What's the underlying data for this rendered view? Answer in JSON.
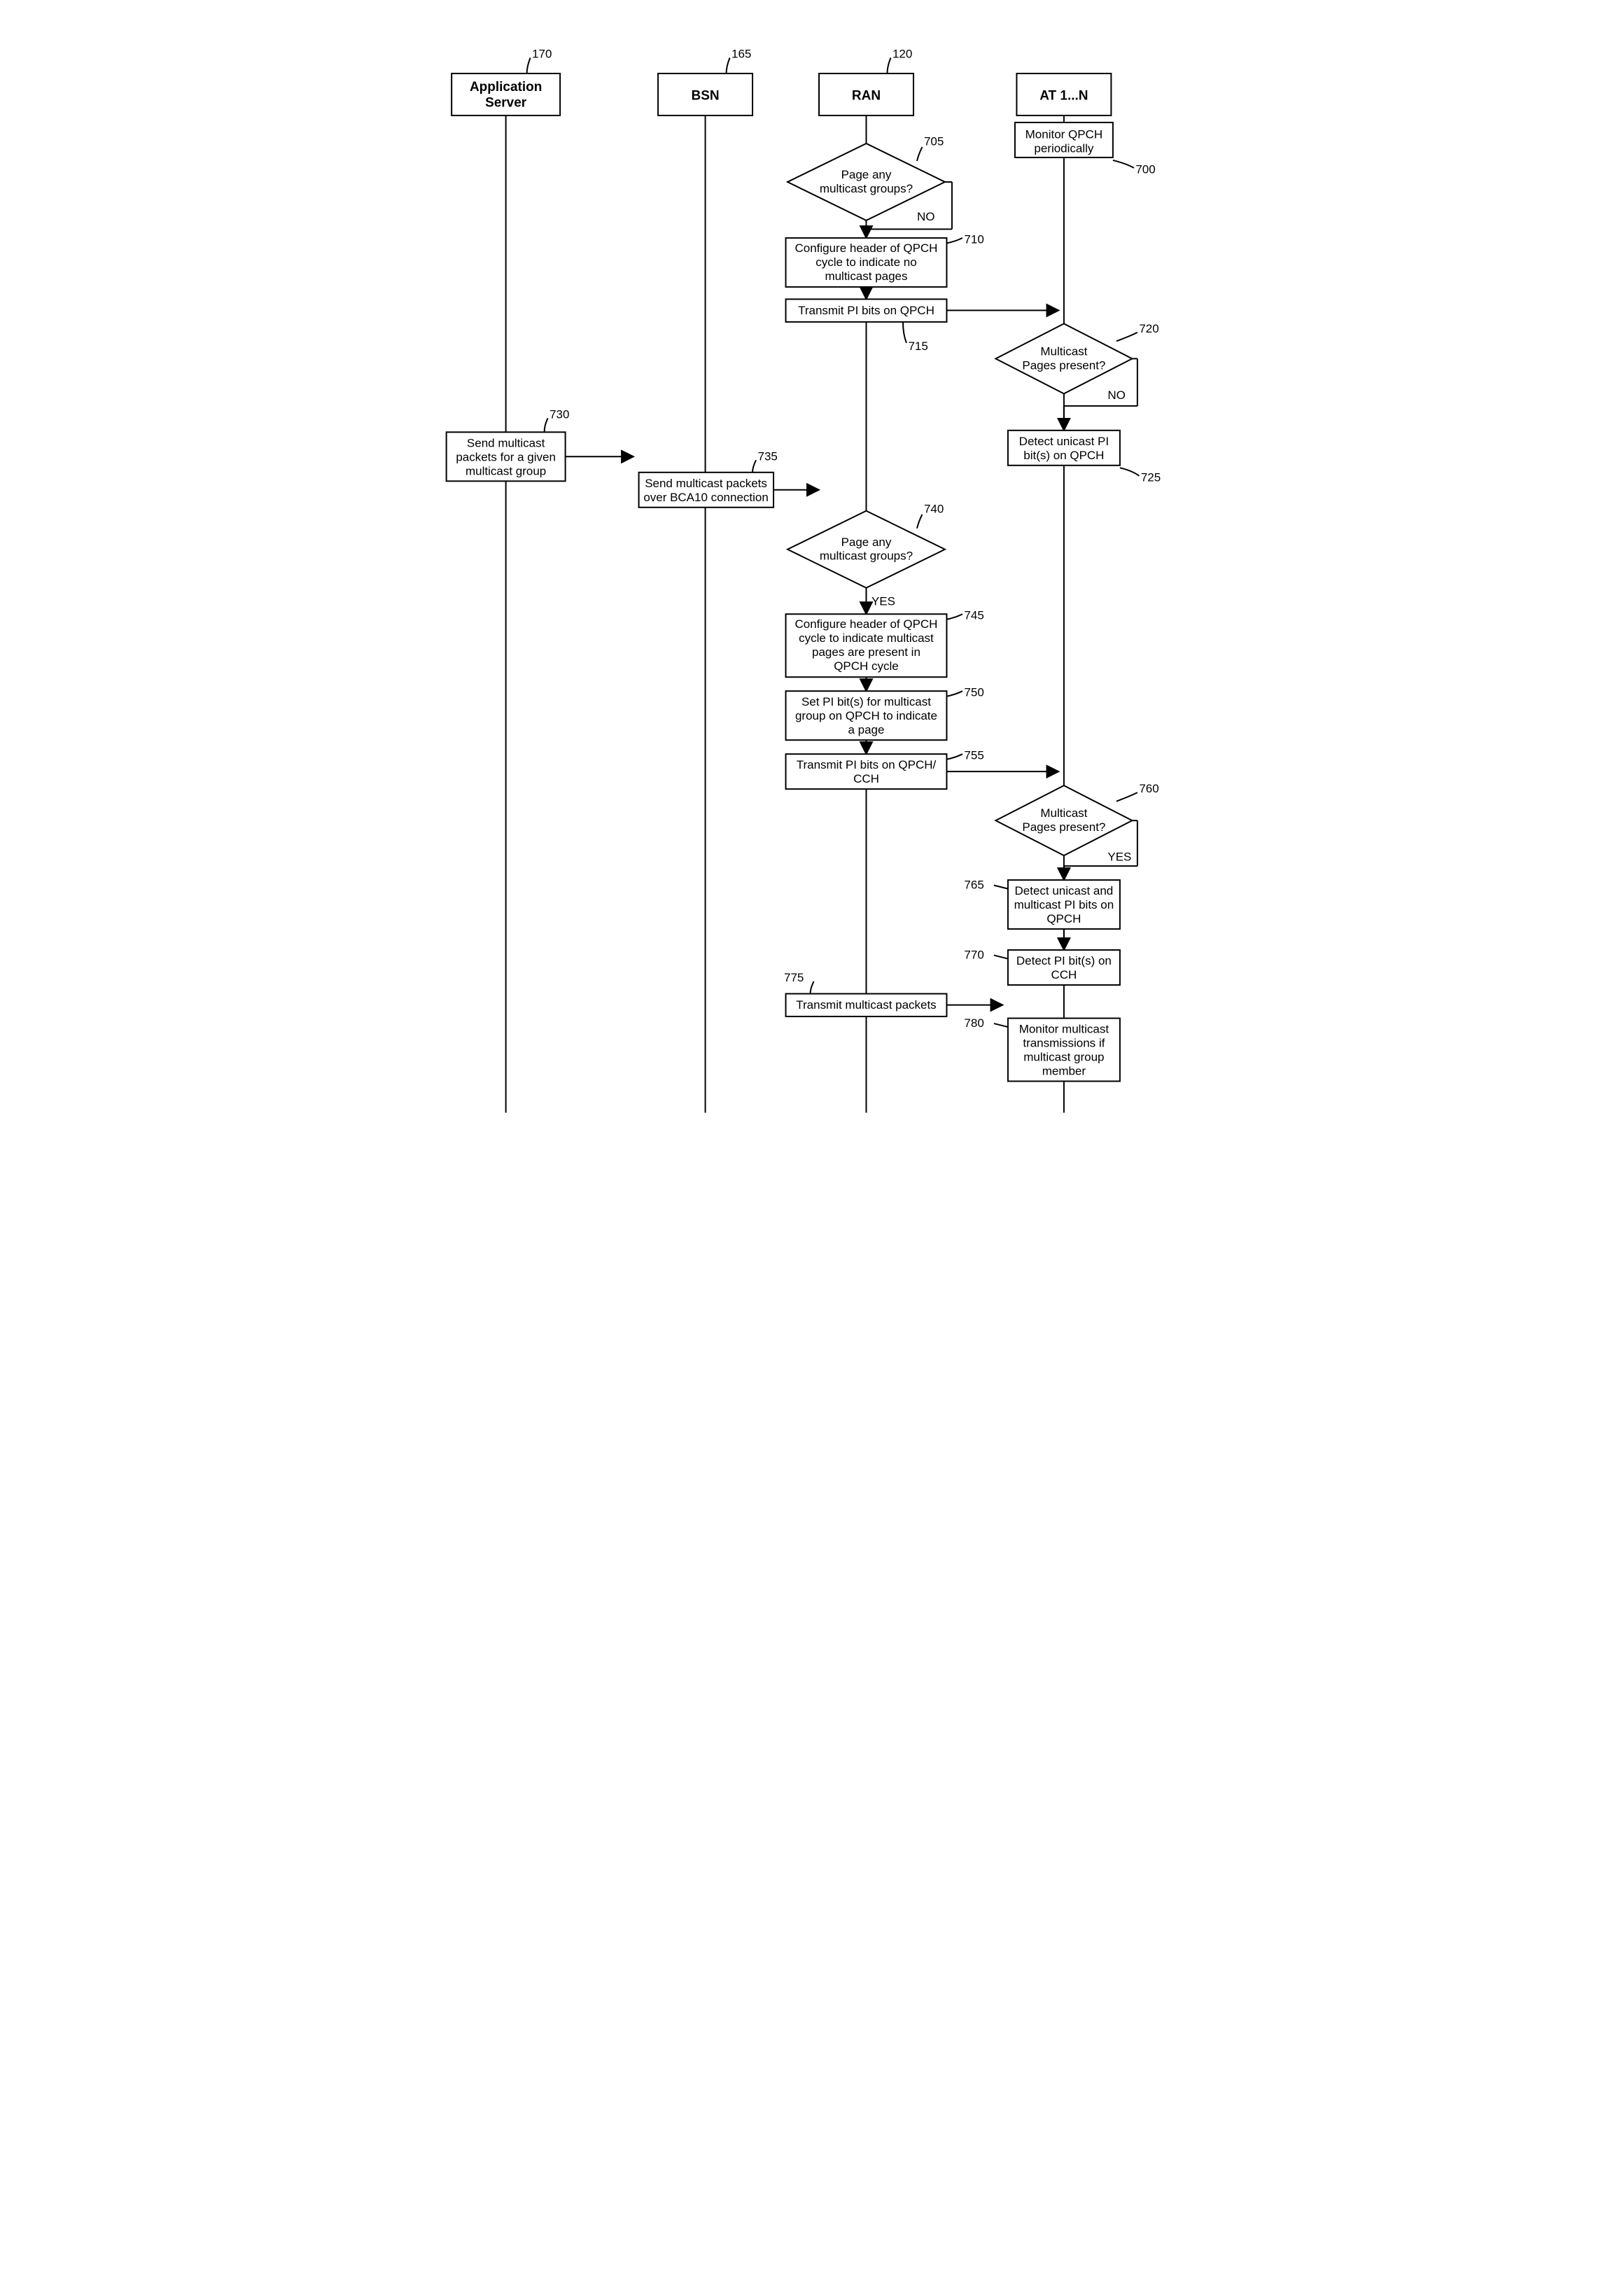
{
  "headers": {
    "appserver": {
      "title1": "Application",
      "title2": "Server",
      "ref": "170"
    },
    "bsn": {
      "title": "BSN",
      "ref": "165"
    },
    "ran": {
      "title": "RAN",
      "ref": "120"
    },
    "at": {
      "title": "AT 1...N"
    }
  },
  "nodes": {
    "n700": {
      "ref": "700",
      "l1": "Monitor QPCH",
      "l2": "periodically"
    },
    "n705": {
      "ref": "705",
      "l1": "Page any",
      "l2": "multicast groups?",
      "branch": "NO"
    },
    "n710": {
      "ref": "710",
      "l1": "Configure header of QPCH",
      "l2": "cycle to indicate no",
      "l3": "multicast pages"
    },
    "n715": {
      "ref": "715",
      "l1": "Transmit PI bits on QPCH"
    },
    "n720": {
      "ref": "720",
      "l1": "Multicast",
      "l2": "Pages present?",
      "branch": "NO"
    },
    "n725": {
      "ref": "725",
      "l1": "Detect unicast PI",
      "l2": "bit(s) on QPCH"
    },
    "n730": {
      "ref": "730",
      "l1": "Send multicast",
      "l2": "packets for a given",
      "l3": "multicast group"
    },
    "n735": {
      "ref": "735",
      "l1": "Send multicast packets",
      "l2": "over BCA10 connection"
    },
    "n740": {
      "ref": "740",
      "l1": "Page any",
      "l2": "multicast groups?",
      "branch": "YES"
    },
    "n745": {
      "ref": "745",
      "l1": "Configure header of QPCH",
      "l2": "cycle to indicate multicast",
      "l3": "pages are present in",
      "l4": "QPCH cycle"
    },
    "n750": {
      "ref": "750",
      "l1": "Set PI bit(s) for multicast",
      "l2": "group on QPCH to indicate",
      "l3": "a page"
    },
    "n755": {
      "ref": "755",
      "l1": "Transmit PI bits on QPCH/",
      "l2": "CCH"
    },
    "n760": {
      "ref": "760",
      "l1": "Multicast",
      "l2": "Pages present?",
      "branch": "YES"
    },
    "n765": {
      "ref": "765",
      "l1": "Detect unicast and",
      "l2": "multicast PI bits on",
      "l3": "QPCH"
    },
    "n770": {
      "ref": "770",
      "l1": "Detect PI bit(s) on",
      "l2": "CCH"
    },
    "n775": {
      "ref": "775",
      "l1": "Transmit multicast packets"
    },
    "n780": {
      "ref": "780",
      "l1": "Monitor multicast",
      "l2": "transmissions if",
      "l3": "multicast group",
      "l4": "member"
    }
  }
}
